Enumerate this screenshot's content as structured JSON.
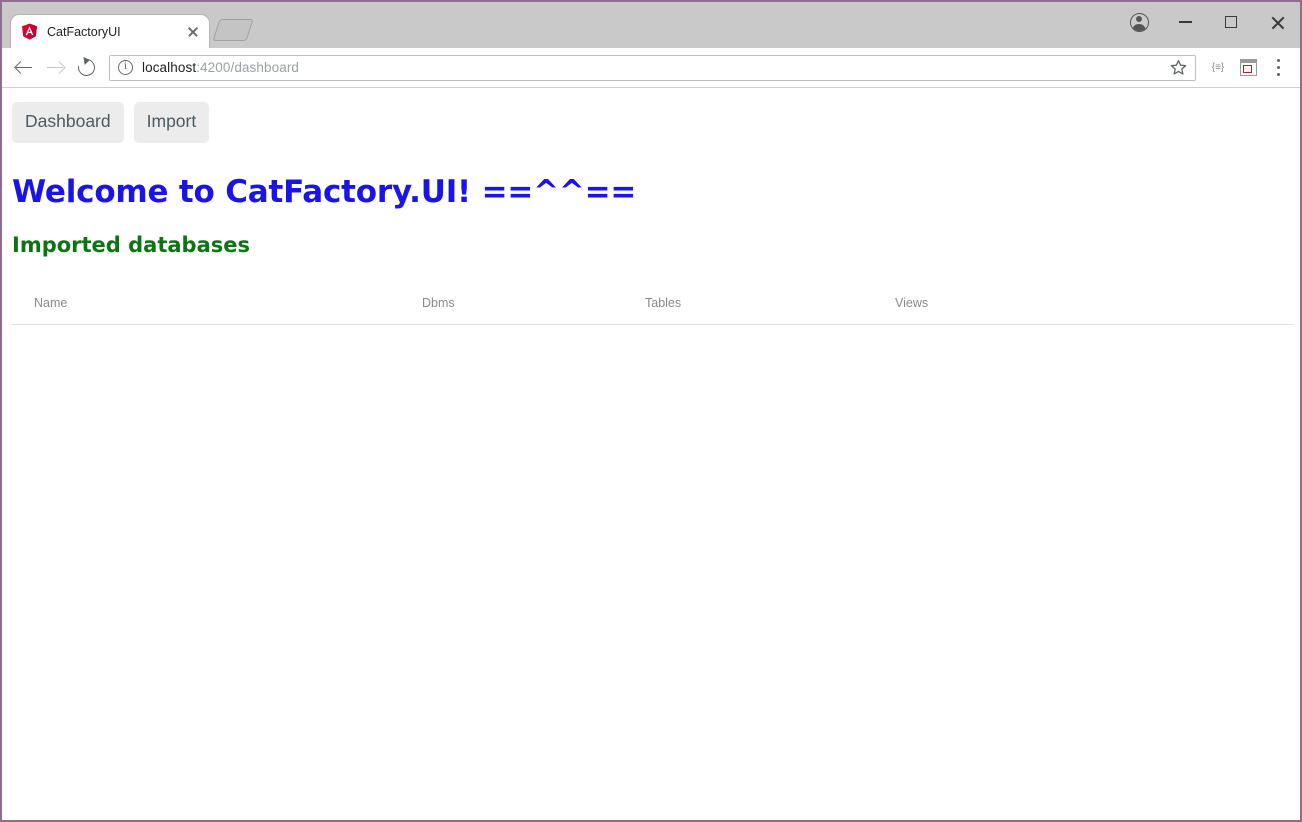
{
  "browser": {
    "tab": {
      "title": "CatFactoryUI",
      "favicon": "angular-logo-icon",
      "close_icon": "close-icon"
    },
    "new_tab_label": "",
    "window_controls": {
      "profile": "profile-icon",
      "minimize": "minimize-icon",
      "maximize": "maximize-icon",
      "close": "close-icon"
    },
    "toolbar": {
      "back": "back-arrow-icon",
      "forward": "forward-arrow-icon",
      "reload": "reload-icon",
      "site_info": "info-icon",
      "url_host": "localhost",
      "url_path": ":4200/dashboard",
      "url_full": "localhost:4200/dashboard",
      "bookmark": "star-icon",
      "extension_one_label": "{≡}",
      "extension_two": "extension-icon",
      "menu": "three-dots-menu-icon"
    }
  },
  "app": {
    "nav": [
      {
        "label": "Dashboard"
      },
      {
        "label": "Import"
      }
    ],
    "welcome_title": "Welcome to CatFactory.UI! ==^^==",
    "section_title": "Imported databases",
    "table": {
      "columns": [
        "Name",
        "Dbms",
        "Tables",
        "Views"
      ],
      "rows": []
    }
  },
  "colors": {
    "welcome": "#1a14e8",
    "section": "#0b7512",
    "window_border": "#8d6f8d",
    "nav_button_bg": "#ececec"
  }
}
